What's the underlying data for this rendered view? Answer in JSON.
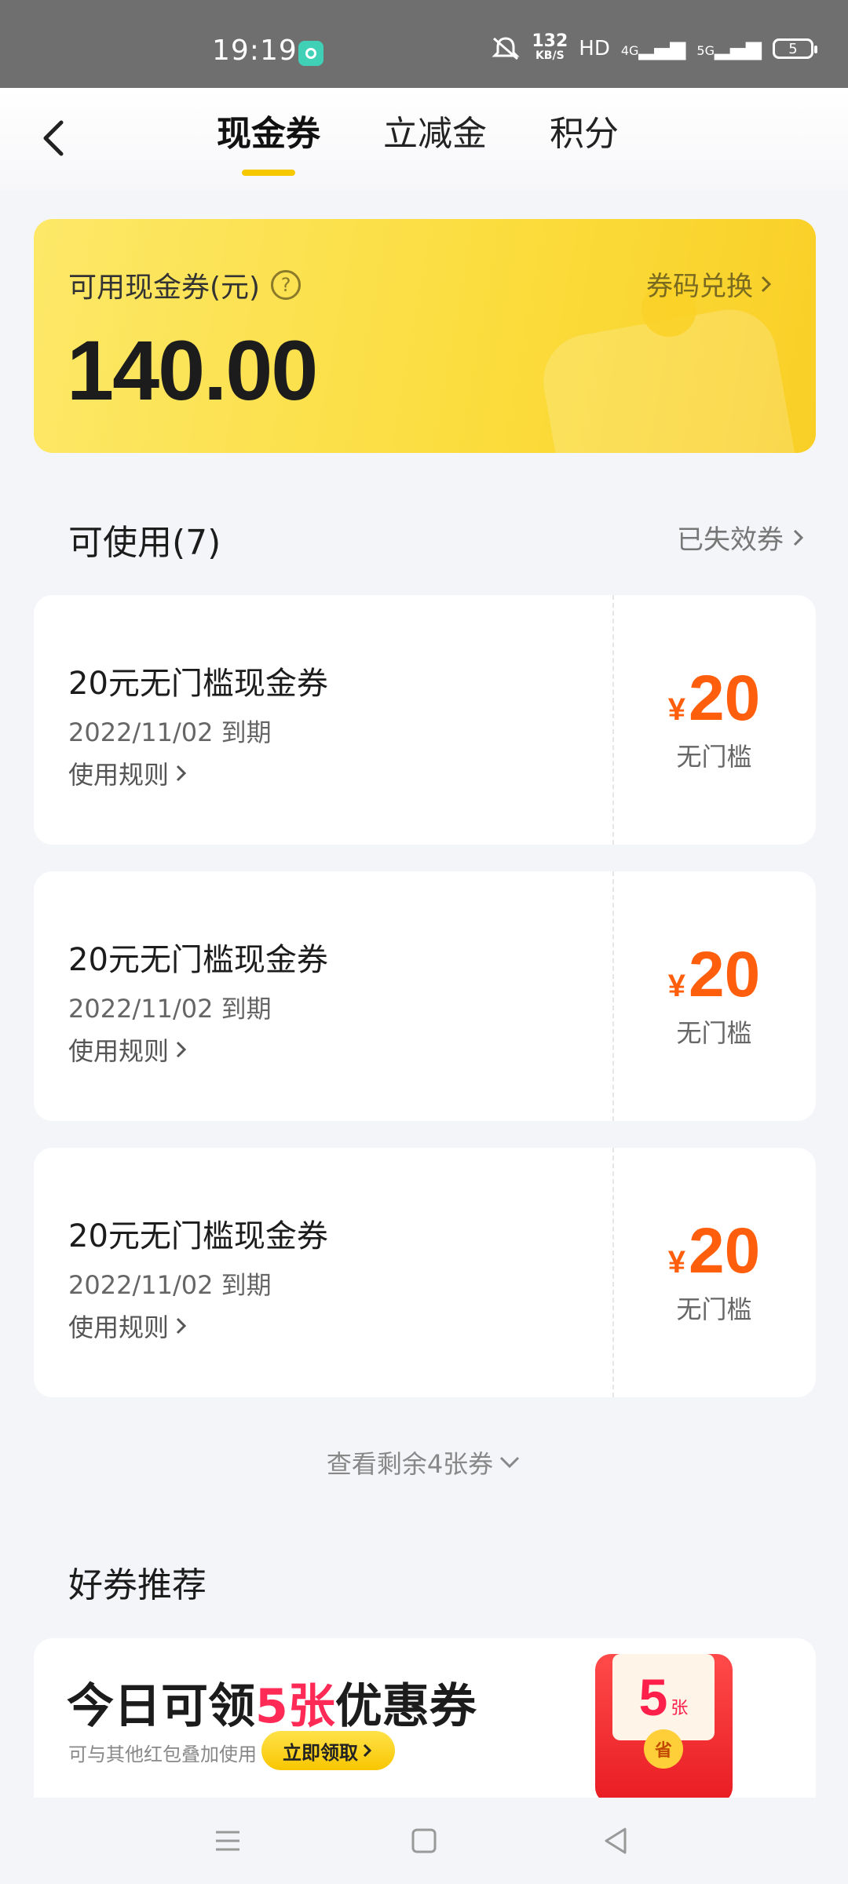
{
  "status_bar": {
    "time": "19:19",
    "speed_value": "132",
    "speed_unit": "KB/S",
    "hd_label": "HD",
    "signal_4g": "4G",
    "signal_5g": "5G",
    "battery": "5"
  },
  "header": {
    "tabs": [
      {
        "label": "现金券",
        "active": true
      },
      {
        "label": "立减金",
        "active": false
      },
      {
        "label": "积分",
        "active": false
      }
    ]
  },
  "balance": {
    "label": "可用现金券(元)",
    "help_symbol": "?",
    "amount": "140.00",
    "redeem_label": "券码兑换"
  },
  "available": {
    "title": "可使用(7)",
    "expired_link": "已失效券"
  },
  "coupons": [
    {
      "title": "20元无门槛现金券",
      "expiry": "2022/11/02 到期",
      "rules": "使用规则",
      "currency": "¥",
      "value": "20",
      "threshold": "无门槛"
    },
    {
      "title": "20元无门槛现金券",
      "expiry": "2022/11/02 到期",
      "rules": "使用规则",
      "currency": "¥",
      "value": "20",
      "threshold": "无门槛"
    },
    {
      "title": "20元无门槛现金券",
      "expiry": "2022/11/02 到期",
      "rules": "使用规则",
      "currency": "¥",
      "value": "20",
      "threshold": "无门槛"
    }
  ],
  "view_more": "查看剩余4张券",
  "recommend": {
    "title": "好券推荐",
    "promo_title_prefix": "今日可领",
    "promo_title_highlight": "5张",
    "promo_title_suffix": "优惠券",
    "promo_sub": "可与其他红包叠加使用",
    "promo_button": "立即领取",
    "envelope_number": "5",
    "envelope_unit": "张",
    "envelope_seal": "省"
  },
  "colors": {
    "accent_yellow": "#f6c800",
    "price_orange": "#ff5f0d",
    "promo_red": "#ff2a55"
  },
  "icons": {
    "back": "chevron-left-icon",
    "help": "question-circle-icon",
    "chevron": "chevron-right-icon",
    "expand": "chevron-down-icon"
  }
}
